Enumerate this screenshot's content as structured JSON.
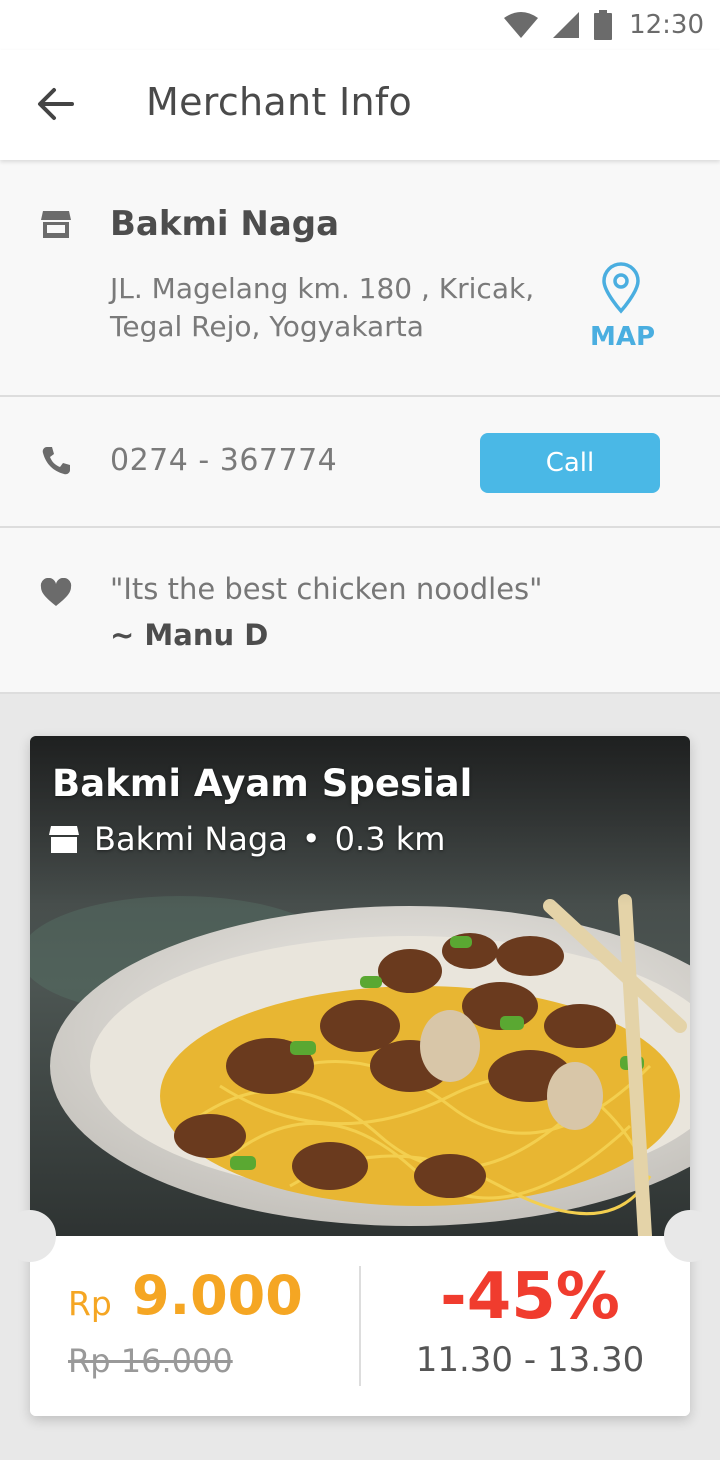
{
  "status_bar": {
    "time": "12:30"
  },
  "app_bar": {
    "title": "Merchant Info"
  },
  "merchant": {
    "name": "Bakmi Naga",
    "address": "JL. Magelang km. 180 , Kricak, Tegal Rejo, Yogyakarta",
    "map_label": "MAP",
    "phone": "0274 - 367774",
    "call_label": "Call",
    "review_quote": "\"Its the best chicken noodles\"",
    "review_author": "~ Manu D"
  },
  "deal": {
    "title": "Bakmi Ayam Spesial",
    "merchant": "Bakmi Naga",
    "separator": "•",
    "distance": "0.3 km",
    "currency": "Rp",
    "price": "9.000",
    "old_price": "Rp 16.000",
    "discount": "-45%",
    "hours": "11.30 - 13.30"
  },
  "colors": {
    "accent_blue": "#4ab8e6",
    "map_blue": "#4aaee0",
    "price_orange": "#f5a623",
    "discount_red": "#f03c2e"
  },
  "icons": {
    "back": "arrow-left-icon",
    "store": "store-icon",
    "map": "map-pin-icon",
    "phone": "phone-icon",
    "review": "heart-icon"
  }
}
